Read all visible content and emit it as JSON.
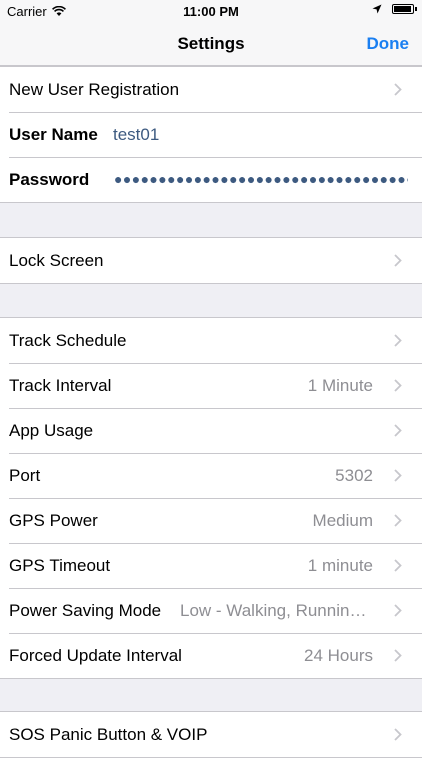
{
  "status_bar": {
    "carrier": "Carrier",
    "time": "11:00 PM",
    "icons": [
      "wifi-icon",
      "location-icon",
      "battery-icon"
    ]
  },
  "nav": {
    "title": "Settings",
    "done_label": "Done"
  },
  "colors": {
    "accent": "#1a7ff1",
    "field_value": "#3d5a80",
    "secondary_text": "#8e8e93",
    "background": "#efeff4",
    "separator": "#c8c7cc"
  },
  "account": {
    "new_user_registration": "New User Registration",
    "username_label": "User Name",
    "username_value": "test01",
    "password_label": "Password",
    "password_value": "●●●●●●●●●●●●●●●●●●●●●●●●●●●●●●●●●●●●●●"
  },
  "lock_screen": {
    "label": "Lock Screen"
  },
  "tracking": {
    "items": [
      {
        "label": "Track Schedule",
        "value": ""
      },
      {
        "label": "Track Interval",
        "value": "1 Minute"
      },
      {
        "label": "App Usage",
        "value": ""
      },
      {
        "label": "Port",
        "value": "5302"
      },
      {
        "label": "GPS Power",
        "value": "Medium"
      },
      {
        "label": "GPS Timeout",
        "value": "1 minute"
      },
      {
        "label": "Power Saving Mode",
        "value": "Low - Walking, Running, Biking"
      },
      {
        "label": "Forced Update Interval",
        "value": "24 Hours"
      }
    ]
  },
  "sos": {
    "label": "SOS Panic Button & VOIP"
  }
}
